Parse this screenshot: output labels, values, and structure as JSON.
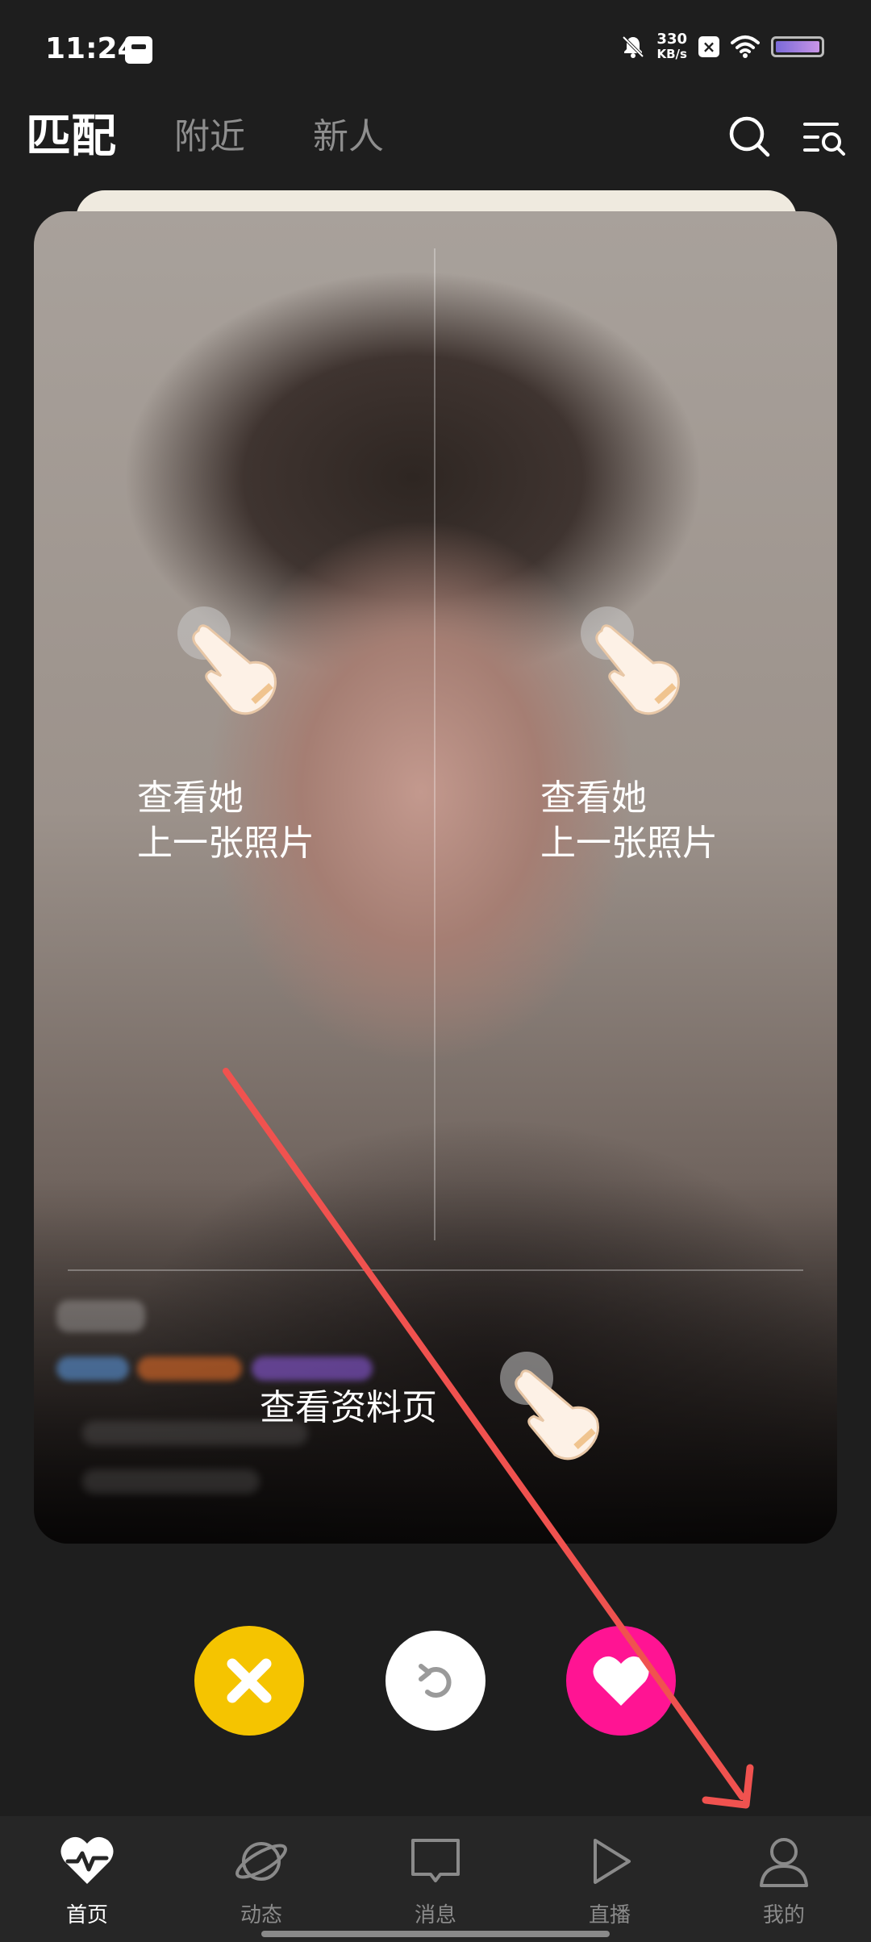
{
  "status_bar": {
    "time": "11:24",
    "net_speed_value": "330",
    "net_speed_unit": "KB/s",
    "battery_icon": "battery-icon"
  },
  "top_tabs": {
    "match": "匹配",
    "nearby": "附近",
    "newcomers": "新人"
  },
  "card": {
    "hint_left": {
      "line1": "查看她",
      "line2": "上一张照片"
    },
    "hint_right": {
      "line1": "查看她",
      "line2": "上一张照片"
    },
    "hint_profile": "查看资料页"
  },
  "actions": {
    "dislike_color": "#F5C400",
    "undo_color": "#FFFFFF",
    "like_color": "#FF1493"
  },
  "bottom_nav": {
    "items": [
      {
        "label": "首页",
        "icon": "heartbeat-icon"
      },
      {
        "label": "动态",
        "icon": "planet-icon"
      },
      {
        "label": "消息",
        "icon": "chat-bubble-icon"
      },
      {
        "label": "直播",
        "icon": "play-icon"
      },
      {
        "label": "我的",
        "icon": "user-icon"
      }
    ]
  },
  "colors": {
    "background": "#1E1E1E",
    "annotation_arrow": "#F0524F"
  }
}
